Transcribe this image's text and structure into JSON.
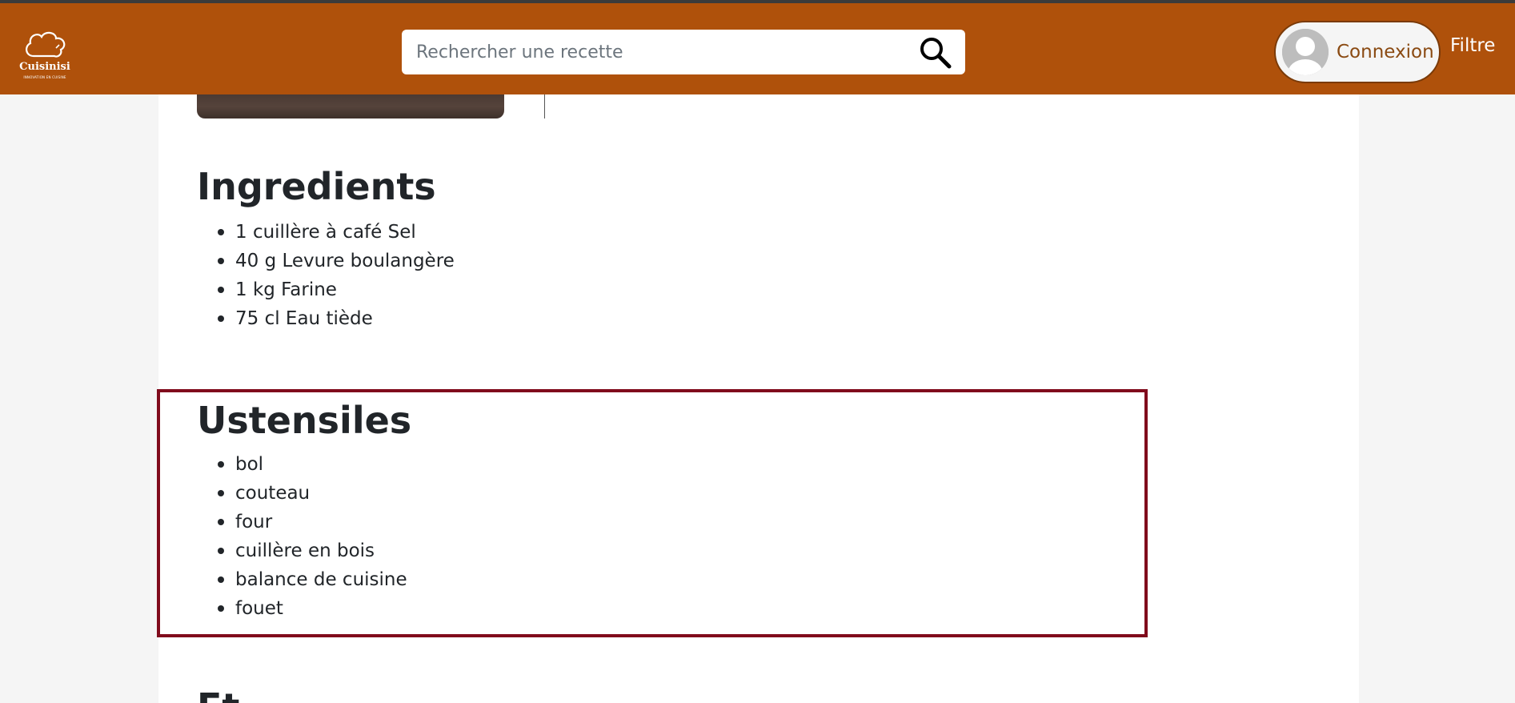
{
  "header": {
    "logo_name": "Cuisinisi",
    "logo_tagline": "INNOVATION EN CUISINE",
    "search_placeholder": "Rechercher une recette",
    "search_icon": "search-icon",
    "login_label": "Connexion",
    "filter_label": "Filtre",
    "brand_color": "#af510b"
  },
  "recipe": {
    "ingredients_title": "Ingredients",
    "ingredients": [
      "1 cuillère à café Sel",
      "40 g Levure boulangère",
      "1 kg Farine",
      "75 cl Eau tiède"
    ],
    "ustensiles_title": "Ustensiles",
    "ustensiles": [
      "bol",
      "couteau",
      "four",
      "cuillère en bois",
      "balance de cuisine",
      "fouet"
    ],
    "next_title": "Et",
    "highlight_color": "#800b1c"
  }
}
